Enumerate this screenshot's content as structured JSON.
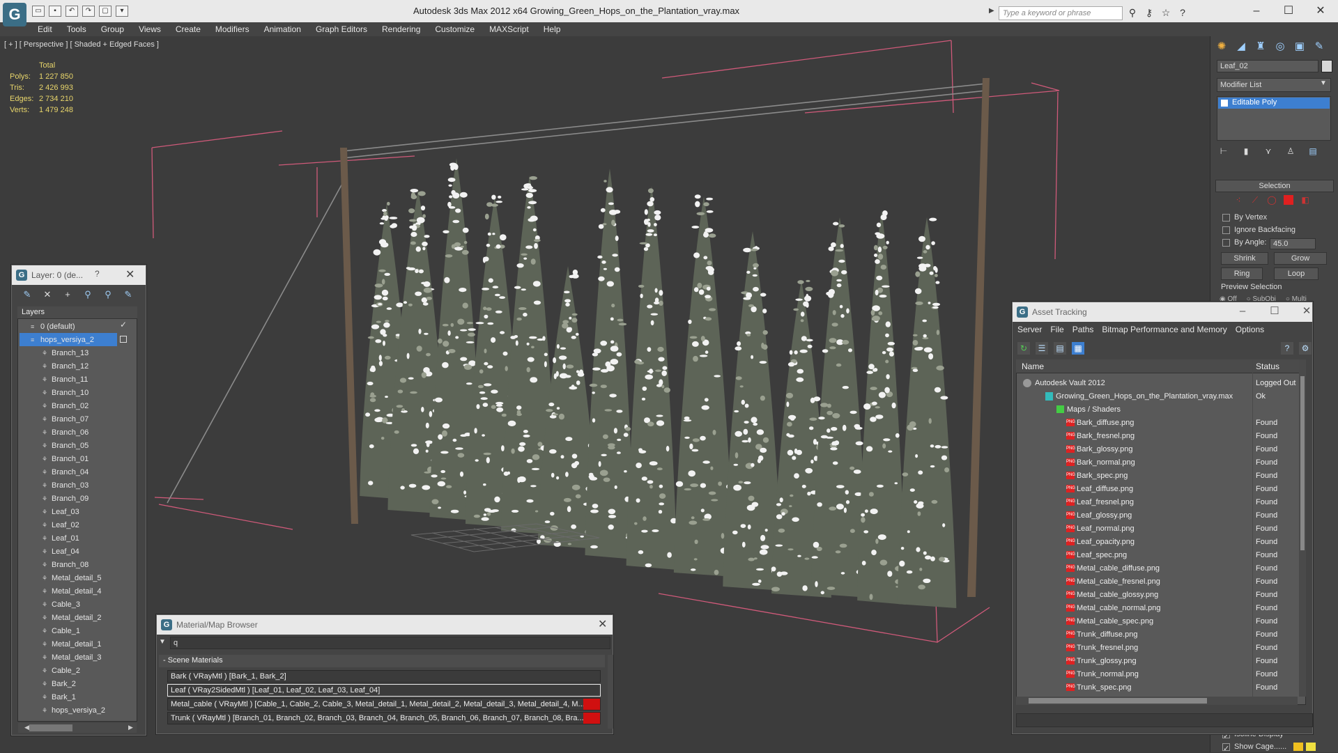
{
  "app": {
    "logo": "G",
    "title": "Autodesk 3ds Max  2012 x64      Growing_Green_Hops_on_the_Plantation_vray.max",
    "search_placeholder": "Type a keyword or phrase",
    "qat_icons": [
      "open-icon",
      "save-icon",
      "undo-icon",
      "redo-icon",
      "project-icon",
      "dropdown-icon"
    ],
    "info_icons": [
      "binoculars-icon",
      "key-icon",
      "star-icon",
      "help-icon"
    ]
  },
  "menu": [
    "Edit",
    "Tools",
    "Group",
    "Views",
    "Create",
    "Modifiers",
    "Animation",
    "Graph Editors",
    "Rendering",
    "Customize",
    "MAXScript",
    "Help"
  ],
  "viewport": {
    "label": "[ + ] [ Perspective ] [ Shaded + Edged Faces ]",
    "stats_header": "Total",
    "stats": [
      {
        "k": "Polys:",
        "v": "1 227 850"
      },
      {
        "k": "Tris:",
        "v": "2 426 993"
      },
      {
        "k": "Edges:",
        "v": "2 734 210"
      },
      {
        "k": "Verts:",
        "v": "1 479 248"
      }
    ],
    "accent_color": "#e9d66b"
  },
  "command_panel": {
    "object_name": "Leaf_02",
    "modifier_list": "Modifier List",
    "modifier_item": "Editable Poly",
    "selection_title": "Selection",
    "by_vertex": "By Vertex",
    "ignore_backfacing": "Ignore Backfacing",
    "by_angle": "By Angle:",
    "angle_value": "45.0",
    "shrink": "Shrink",
    "grow": "Grow",
    "ring": "Ring",
    "loop": "Loop",
    "preview_selection": "Preview Selection",
    "preview_opts": [
      "Off",
      "SubObj",
      "Multi"
    ],
    "isoline": "Isoline Display",
    "show_cage": "Show Cage......"
  },
  "layer_dialog": {
    "title": "Layer: 0 (de...",
    "help": "?",
    "header": "Layers",
    "rows": [
      {
        "label": "0 (default)",
        "indent": 0,
        "selected": false
      },
      {
        "label": "hops_versiya_2",
        "indent": 0,
        "selected": true
      },
      {
        "label": "Branch_13",
        "indent": 1
      },
      {
        "label": "Branch_12",
        "indent": 1
      },
      {
        "label": "Branch_11",
        "indent": 1
      },
      {
        "label": "Branch_10",
        "indent": 1
      },
      {
        "label": "Branch_02",
        "indent": 1
      },
      {
        "label": "Branch_07",
        "indent": 1
      },
      {
        "label": "Branch_06",
        "indent": 1
      },
      {
        "label": "Branch_05",
        "indent": 1
      },
      {
        "label": "Branch_01",
        "indent": 1
      },
      {
        "label": "Branch_04",
        "indent": 1
      },
      {
        "label": "Branch_03",
        "indent": 1
      },
      {
        "label": "Branch_09",
        "indent": 1
      },
      {
        "label": "Leaf_03",
        "indent": 1
      },
      {
        "label": "Leaf_02",
        "indent": 1
      },
      {
        "label": "Leaf_01",
        "indent": 1
      },
      {
        "label": "Leaf_04",
        "indent": 1
      },
      {
        "label": "Branch_08",
        "indent": 1
      },
      {
        "label": "Metal_detail_5",
        "indent": 1
      },
      {
        "label": "Metal_detail_4",
        "indent": 1
      },
      {
        "label": "Cable_3",
        "indent": 1
      },
      {
        "label": "Metal_detail_2",
        "indent": 1
      },
      {
        "label": "Cable_1",
        "indent": 1
      },
      {
        "label": "Metal_detail_1",
        "indent": 1
      },
      {
        "label": "Metal_detail_3",
        "indent": 1
      },
      {
        "label": "Cable_2",
        "indent": 1
      },
      {
        "label": "Bark_2",
        "indent": 1
      },
      {
        "label": "Bark_1",
        "indent": 1
      },
      {
        "label": "hops_versiya_2",
        "indent": 1
      }
    ]
  },
  "material_browser": {
    "title": "Material/Map Browser",
    "search_value": "q",
    "group": "- Scene Materials",
    "rows": [
      {
        "text": "Bark  ( VRayMtl )  [Bark_1, Bark_2]",
        "selected": false,
        "red": false
      },
      {
        "text": "Leaf  ( VRay2SidedMtl )  [Leaf_01, Leaf_02, Leaf_03, Leaf_04]",
        "selected": true,
        "red": false
      },
      {
        "text": "Metal_cable  ( VRayMtl )  [Cable_1, Cable_2, Cable_3, Metal_detail_1, Metal_detail_2, Metal_detail_3, Metal_detail_4, M...",
        "selected": false,
        "red": true
      },
      {
        "text": "Trunk   ( VRayMtl )   [Branch_01, Branch_02, Branch_03, Branch_04, Branch_05, Branch_06, Branch_07, Branch_08, Bra...",
        "selected": false,
        "red": true
      }
    ]
  },
  "asset_tracking": {
    "title": "Asset Tracking",
    "menu": [
      "Server",
      "File",
      "Paths",
      "Bitmap Performance and Memory",
      "Options"
    ],
    "col_name": "Name",
    "col_status": "Status",
    "rows": [
      {
        "name": "Autodesk Vault 2012",
        "status": "Logged Out",
        "type": "vault",
        "indent": 0
      },
      {
        "name": "Growing_Green_Hops_on_the_Plantation_vray.max",
        "status": "Ok",
        "type": "max",
        "indent": 1
      },
      {
        "name": "Maps / Shaders",
        "status": "",
        "type": "maps",
        "indent": 2
      },
      {
        "name": "Bark_diffuse.png",
        "status": "Found",
        "type": "png",
        "indent": 3
      },
      {
        "name": "Bark_fresnel.png",
        "status": "Found",
        "type": "png",
        "indent": 3
      },
      {
        "name": "Bark_glossy.png",
        "status": "Found",
        "type": "png",
        "indent": 3
      },
      {
        "name": "Bark_normal.png",
        "status": "Found",
        "type": "png",
        "indent": 3
      },
      {
        "name": "Bark_spec.png",
        "status": "Found",
        "type": "png",
        "indent": 3
      },
      {
        "name": "Leaf_diffuse.png",
        "status": "Found",
        "type": "png",
        "indent": 3
      },
      {
        "name": "Leaf_fresnel.png",
        "status": "Found",
        "type": "png",
        "indent": 3
      },
      {
        "name": "Leaf_glossy.png",
        "status": "Found",
        "type": "png",
        "indent": 3
      },
      {
        "name": "Leaf_normal.png",
        "status": "Found",
        "type": "png",
        "indent": 3
      },
      {
        "name": "Leaf_opacity.png",
        "status": "Found",
        "type": "png",
        "indent": 3
      },
      {
        "name": "Leaf_spec.png",
        "status": "Found",
        "type": "png",
        "indent": 3
      },
      {
        "name": "Metal_cable_diffuse.png",
        "status": "Found",
        "type": "png",
        "indent": 3
      },
      {
        "name": "Metal_cable_fresnel.png",
        "status": "Found",
        "type": "png",
        "indent": 3
      },
      {
        "name": "Metal_cable_glossy.png",
        "status": "Found",
        "type": "png",
        "indent": 3
      },
      {
        "name": "Metal_cable_normal.png",
        "status": "Found",
        "type": "png",
        "indent": 3
      },
      {
        "name": "Metal_cable_spec.png",
        "status": "Found",
        "type": "png",
        "indent": 3
      },
      {
        "name": "Trunk_diffuse.png",
        "status": "Found",
        "type": "png",
        "indent": 3
      },
      {
        "name": "Trunk_fresnel.png",
        "status": "Found",
        "type": "png",
        "indent": 3
      },
      {
        "name": "Trunk_glossy.png",
        "status": "Found",
        "type": "png",
        "indent": 3
      },
      {
        "name": "Trunk_normal.png",
        "status": "Found",
        "type": "png",
        "indent": 3
      },
      {
        "name": "Trunk_spec.png",
        "status": "Found",
        "type": "png",
        "indent": 3
      }
    ]
  }
}
